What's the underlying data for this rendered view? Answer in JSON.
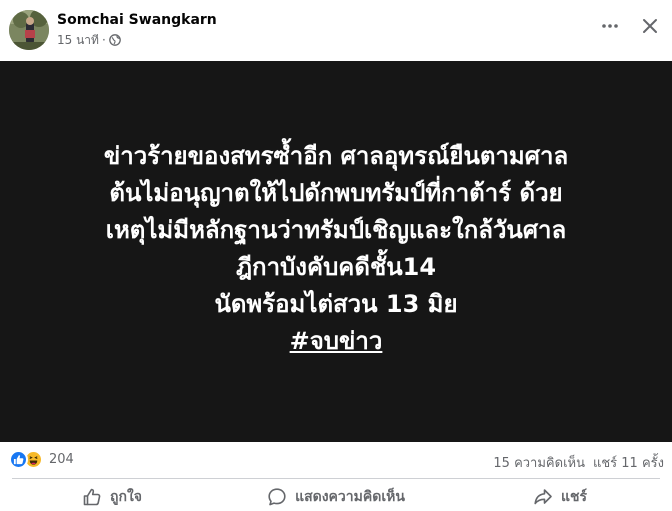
{
  "post": {
    "author": "Somchai Swangkarn",
    "time": "15 นาที",
    "separator": "·",
    "privacy_icon": "globe-icon",
    "more_icon": "ellipsis-icon",
    "close_icon": "close-icon"
  },
  "content": {
    "lines": [
      "ข่าวร้ายของสทรซ้ำอีก ศาลอุทรณ์ยืนตามศาล",
      "ต้นไม่อนุญาตให้ไปดักพบทรัมป์ที่กาต้าร์ ด้วย",
      "เหตุไม่มีหลักฐานว่าทรัมป์เชิญและใกล้วันศาล",
      "ฎีกาบังคับคดีชั้น14",
      "นัดพร้อมไต่สวน 13 มิย"
    ],
    "hashtag": "#จบข่าว",
    "background_color": "#161616",
    "text_color": "#ffffff"
  },
  "stats": {
    "reaction_icons": [
      "like-icon",
      "haha-icon"
    ],
    "reaction_count": "204",
    "comments": "15 ความคิดเห็น",
    "shares": "แชร์ 11 ครั้ง"
  },
  "actions": {
    "like": "ถูกใจ",
    "comment": "แสดงความคิดเห็น",
    "share": "แชร์"
  },
  "colors": {
    "like_blue": "#1877f2",
    "haha_yellow": "#f7b928",
    "secondary_text": "#65676b"
  }
}
